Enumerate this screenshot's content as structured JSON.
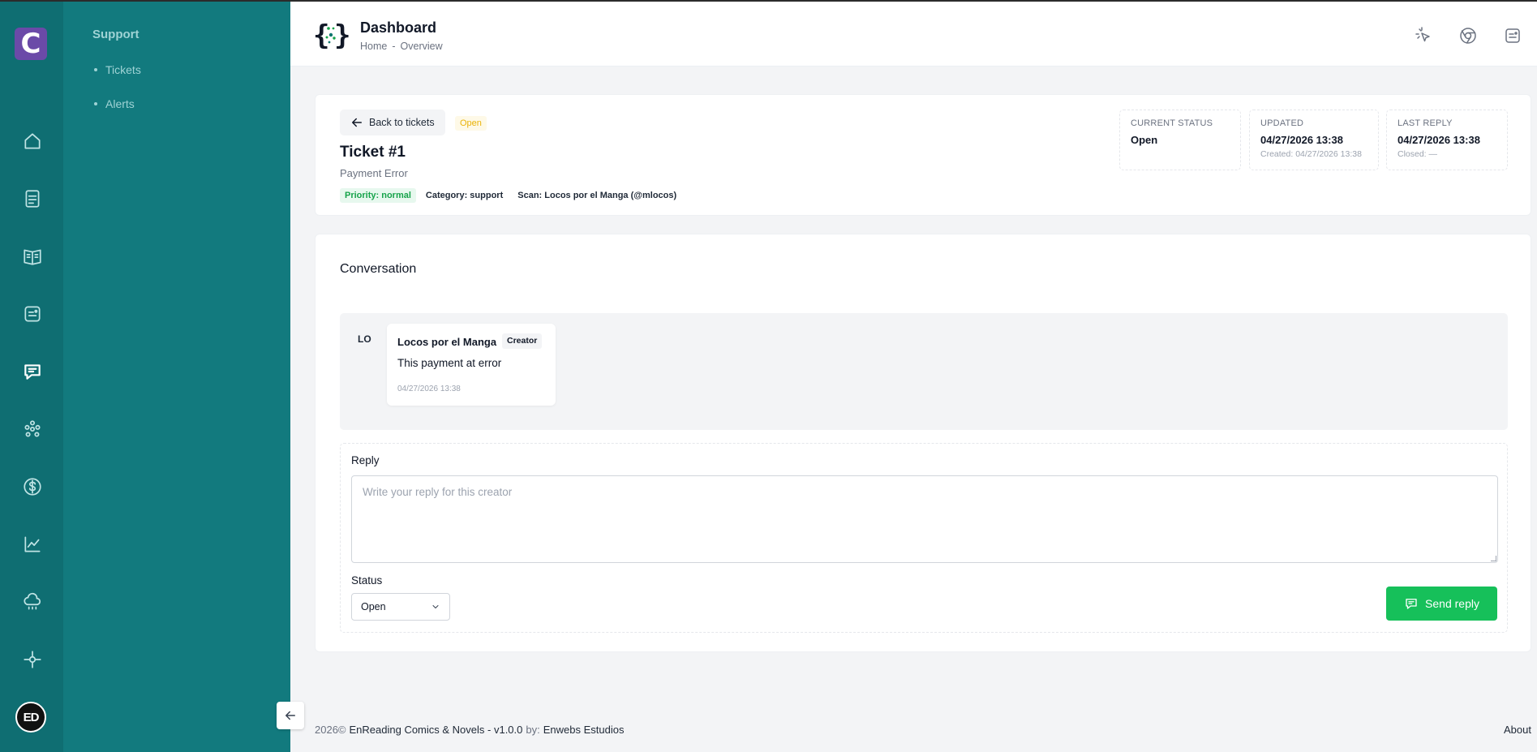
{
  "sidebar": {
    "logo_letter": "C",
    "icons": [
      "home-icon",
      "document-icon",
      "book-icon",
      "ticket-icon",
      "chat-icon",
      "users-icon",
      "dollar-icon",
      "chart-icon",
      "cloud-icon",
      "settings-icon"
    ],
    "active": "chat-icon",
    "user_initials": "ED"
  },
  "submenu": {
    "title": "Support",
    "items": [
      {
        "label": "Tickets"
      },
      {
        "label": "Alerts"
      }
    ]
  },
  "header": {
    "title": "Dashboard",
    "breadcrumbs": [
      "Home",
      "Overview"
    ],
    "breadcrumb_separator": "-"
  },
  "ticket": {
    "back_label": "Back to tickets",
    "status_pill": "Open",
    "title": "Ticket #1",
    "subject": "Payment Error",
    "tags": [
      "Priority: normal",
      "Category: support",
      "Scan: Locos por el Manga (@mlocos)"
    ],
    "stats": {
      "current_status": {
        "label": "CURRENT STATUS",
        "value": "Open"
      },
      "updated": {
        "label": "UPDATED",
        "value": "04/27/2026 13:38",
        "sub": "Created: 04/27/2026 13:38"
      },
      "last_reply": {
        "label": "LAST REPLY",
        "value": "04/27/2026 13:38",
        "sub": "Closed: —"
      }
    }
  },
  "conversation": {
    "title": "Conversation",
    "messages": [
      {
        "avatar": "LO",
        "author": "Locos por el Manga",
        "role": "Creator",
        "text": "This payment at error",
        "time": "04/27/2026 13:38"
      }
    ],
    "reply": {
      "label": "Reply",
      "placeholder": "Write your reply for this creator",
      "value": "",
      "status_label": "Status",
      "status_value": "Open",
      "send_label": "Send reply"
    }
  },
  "footer": {
    "year": "2026©",
    "product": "EnReading Comics & Novels - v1.0.0",
    "by": "by:",
    "company": "Enwebs Estudios",
    "about": "About"
  },
  "colors": {
    "rail": "#0f6e72",
    "submenu": "#127a7e",
    "logo": "#6b4aa8",
    "primary_button": "#16c05a",
    "open_badge": "#eab308",
    "priority_badge": "#16a34a"
  }
}
